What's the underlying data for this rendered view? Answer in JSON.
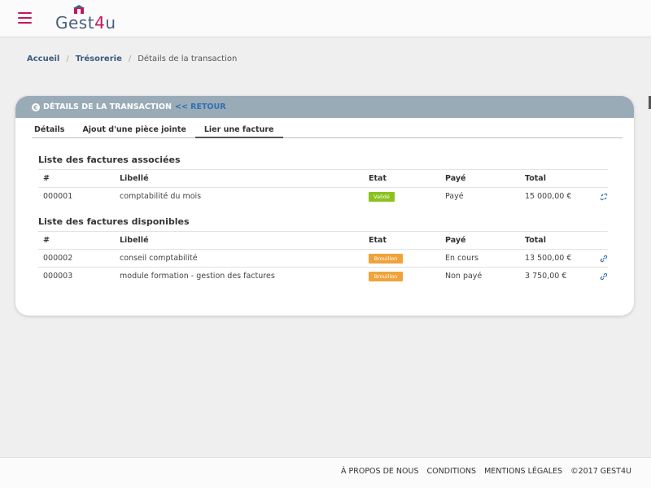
{
  "header": {
    "logo_text_a": "Gest",
    "logo_text_b": "4",
    "logo_text_c": "u",
    "menu_icon": "hamburger-icon",
    "accent_color": "#c2185b"
  },
  "breadcrumb": {
    "items": [
      "Accueil",
      "Trésorerie",
      "Détails de la transaction"
    ],
    "separator": "/"
  },
  "card": {
    "title": "DÉTAILS DE LA TRANSACTION",
    "back_label": "<< RETOUR",
    "icon": "euro-icon",
    "header_color": "#9aabb8"
  },
  "tabs": [
    {
      "label": "Détails",
      "active": false
    },
    {
      "label": "Ajout d'une pièce jointe",
      "active": false
    },
    {
      "label": "Lier une facture",
      "active": true
    }
  ],
  "associated": {
    "title": "Liste des factures associées",
    "columns": [
      "#",
      "Libellé",
      "Etat",
      "Payé",
      "Total"
    ],
    "rows": [
      {
        "num": "000001",
        "label": "comptabilité du mois",
        "state": "Validé",
        "paid": "Payé",
        "total": "15 000,00 €",
        "action_icon": "unlink-icon"
      }
    ]
  },
  "available": {
    "title": "Liste des factures disponibles",
    "columns": [
      "#",
      "Libellé",
      "Etat",
      "Payé",
      "Total"
    ],
    "rows": [
      {
        "num": "000002",
        "label": "conseil comptabilité",
        "state": "Brouillon",
        "paid": "En cours",
        "total": "13 500,00 €",
        "action_icon": "link-icon"
      },
      {
        "num": "000003",
        "label": "module formation - gestion des factures",
        "state": "Brouillon",
        "paid": "Non payé",
        "total": "3 750,00 €",
        "action_icon": "link-icon"
      }
    ]
  },
  "status_colors": {
    "Validé": "#8bc21f",
    "Brouillon": "#f0a33a"
  },
  "footer": {
    "links": [
      "À PROPOS DE NOUS",
      "CONDITIONS",
      "MENTIONS LÉGALES"
    ],
    "copyright": "©2017 GEST4U"
  }
}
